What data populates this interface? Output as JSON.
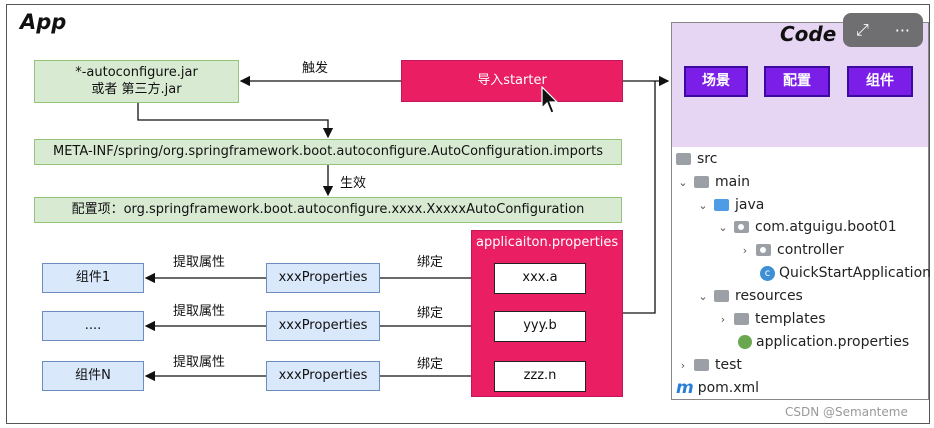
{
  "app_title": "App",
  "code_title": "Code",
  "trigger_label": "触发",
  "effect_label": "生效",
  "boxes": {
    "autoconfigure_jar": [
      "*-autoconfigure.jar",
      "或者 第三方.jar"
    ],
    "import_starter": "导入starter",
    "imports_file": "META-INF/spring/org.springframework.boot.autoconfigure.AutoConfiguration.imports",
    "config_item": "配置项：org.springframework.boot.autoconfigure.xxxx.XxxxxAutoConfiguration"
  },
  "code_buttons": [
    "场景",
    "配置",
    "组件"
  ],
  "properties_panel": {
    "title": "applicaiton.properties",
    "keys": [
      "xxx.a",
      "yyy.b",
      "zzz.n"
    ]
  },
  "rows": [
    {
      "component": "组件1",
      "extract_label": "提取属性",
      "properties_class": "xxxProperties",
      "bind_label": "绑定"
    },
    {
      "component": "....",
      "extract_label": "提取属性",
      "properties_class": "xxxProperties",
      "bind_label": "绑定"
    },
    {
      "component": "组件N",
      "extract_label": "提取属性",
      "properties_class": "xxxProperties",
      "bind_label": "绑定"
    }
  ],
  "tree": [
    {
      "label": "src",
      "chev": "",
      "icon": "folder"
    },
    {
      "label": "main",
      "chev": "⌄",
      "icon": "folder"
    },
    {
      "label": "java",
      "chev": "⌄",
      "icon": "folder-blue"
    },
    {
      "label": "com.atguigu.boot01",
      "chev": "⌄",
      "icon": "package"
    },
    {
      "label": "controller",
      "chev": "›",
      "icon": "package"
    },
    {
      "label": "QuickStartApplication",
      "chev": "",
      "icon": "class"
    },
    {
      "label": "resources",
      "chev": "⌄",
      "icon": "folder-res"
    },
    {
      "label": "templates",
      "chev": "›",
      "icon": "folder"
    },
    {
      "label": "application.properties",
      "chev": "",
      "icon": "leaf"
    },
    {
      "label": "test",
      "chev": "›",
      "icon": "folder"
    },
    {
      "label": "pom.xml",
      "chev": "",
      "icon": "maven"
    }
  ],
  "viewer_controls": [
    "expand-icon",
    "more-icon"
  ],
  "watermark": "CSDN @Semanteme",
  "colors": {
    "pink": "#e91e63",
    "green": "#d9ead3",
    "blue": "#dae8fc",
    "violet": "#7b1fe8",
    "lavender": "#e6d6f3"
  }
}
